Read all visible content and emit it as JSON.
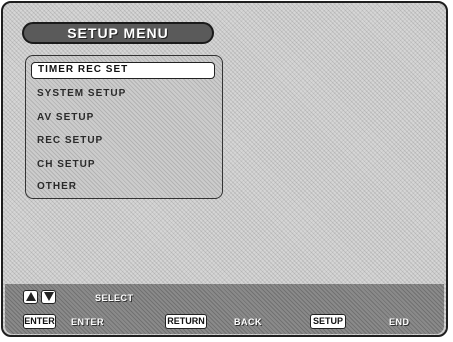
{
  "title": "SETUP MENU",
  "menu": {
    "items": [
      {
        "label": "TIMER REC SET",
        "selected": true
      },
      {
        "label": "SYSTEM SETUP",
        "selected": false
      },
      {
        "label": "AV SETUP",
        "selected": false
      },
      {
        "label": "REC SETUP",
        "selected": false
      },
      {
        "label": "CH SETUP",
        "selected": false
      },
      {
        "label": "OTHER",
        "selected": false
      }
    ]
  },
  "guide": {
    "select_label": "SELECT",
    "enter_key": "ENTER",
    "enter_label": "ENTER",
    "return_key": "RETURN",
    "return_label": "BACK",
    "setup_key": "SETUP",
    "setup_label": "END"
  },
  "icons": {
    "up": "up-arrow-icon",
    "down": "down-arrow-icon"
  }
}
